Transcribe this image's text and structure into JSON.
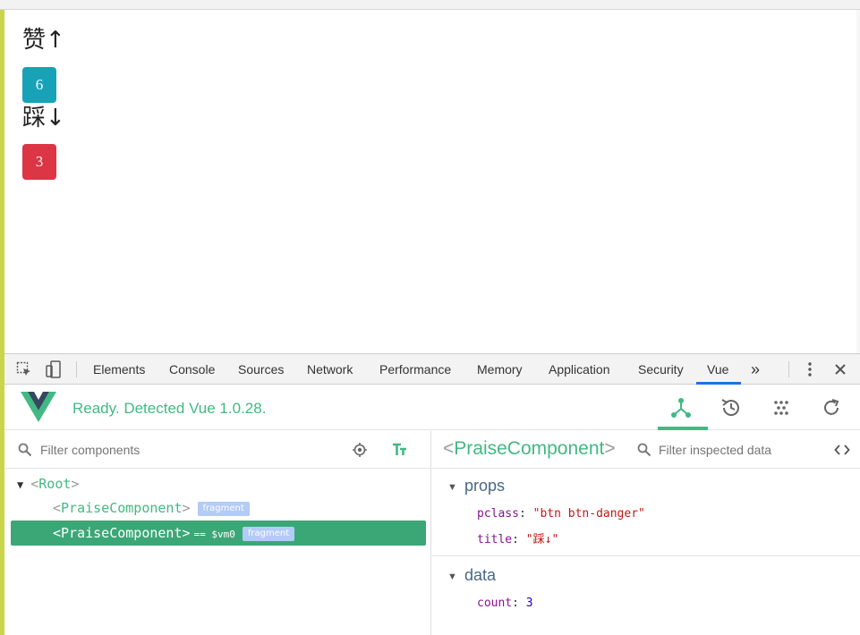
{
  "page": {
    "praise": {
      "up_title": "赞↑",
      "up_count": "6",
      "down_title": "踩↓",
      "down_count": "3"
    }
  },
  "devtools": {
    "tabs": [
      "Elements",
      "Console",
      "Sources",
      "Network",
      "Performance",
      "Memory",
      "Application",
      "Security",
      "Vue"
    ],
    "active_tab": "Vue",
    "overflow_glyph": "»",
    "vue": {
      "status": "Ready. Detected Vue 1.0.28.",
      "filter_components_placeholder": "Filter components",
      "filter_inspected_placeholder": "Filter inspected data",
      "inspected_component": "PraiseComponent",
      "tree": {
        "root": "Root",
        "children": [
          {
            "name": "PraiseComponent",
            "tag": "fragment",
            "selected": false,
            "ref": ""
          },
          {
            "name": "PraiseComponent",
            "tag": "fragment",
            "selected": true,
            "ref": "== $vm0"
          }
        ]
      },
      "props_title": "props",
      "props": [
        {
          "key": "pclass",
          "value": "\"btn btn-danger\""
        },
        {
          "key": "title",
          "value": "\"踩↓\""
        }
      ],
      "data_title": "data",
      "data": [
        {
          "key": "count",
          "value": "3"
        }
      ]
    },
    "colors": {
      "vue_green": "#42b983",
      "selected_row": "#3ba776",
      "tag_bg": "#b3cbf7",
      "btn_info": "#17a2b8",
      "btn_danger": "#dc3545",
      "tab_active": "#1a73e8"
    },
    "icons": [
      "inspect-element-icon",
      "device-toolbar-icon",
      "kebab-menu-icon",
      "close-icon",
      "component-tree-icon",
      "history-icon",
      "vuex-icon",
      "refresh-icon",
      "search-icon",
      "target-icon",
      "text-format-icon",
      "code-icon"
    ]
  }
}
